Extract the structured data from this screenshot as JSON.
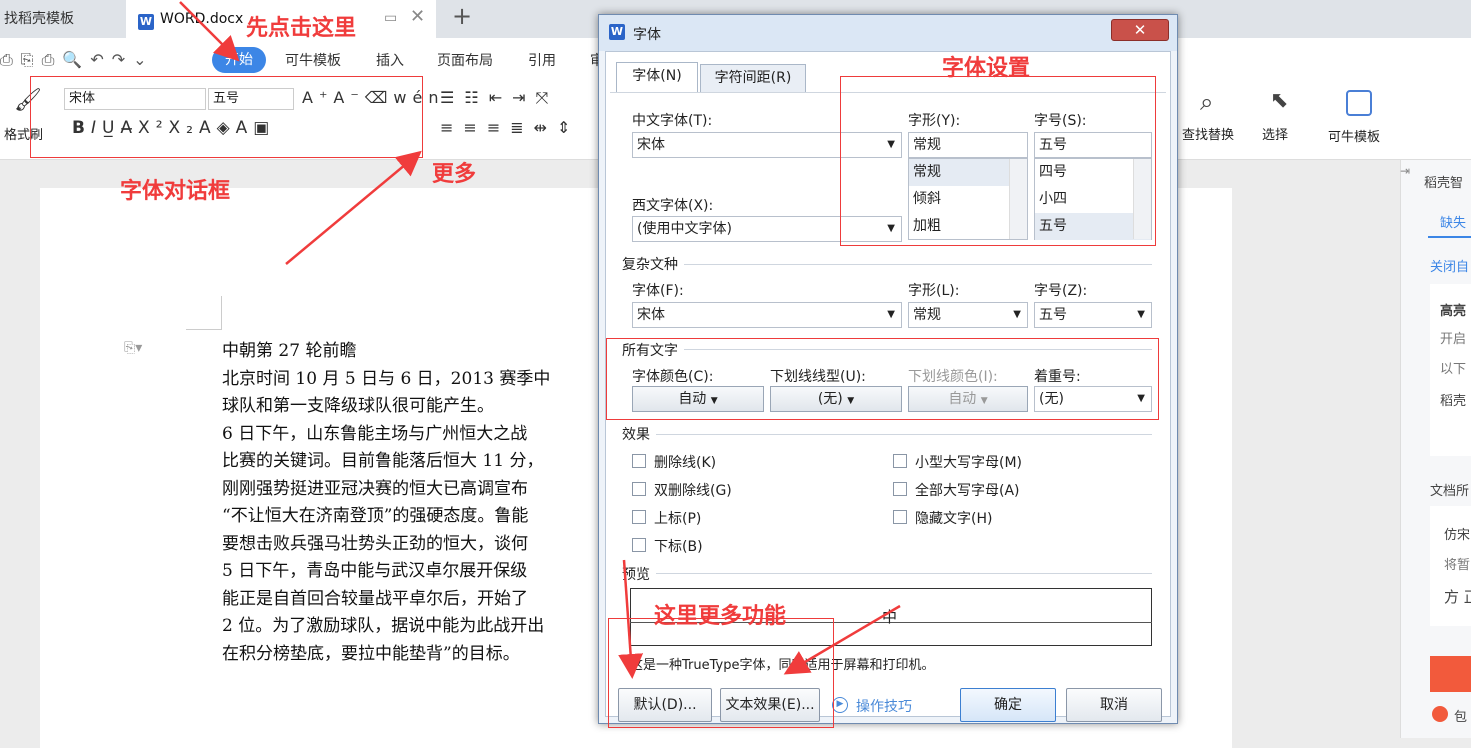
{
  "tabs": {
    "tab1": "找稻壳模板",
    "tab2": "WORD.docx"
  },
  "menu": {
    "start": "开始",
    "items": [
      "可牛模板",
      "插入",
      "页面布局",
      "引用",
      "审"
    ]
  },
  "toolbar": {
    "format_painter": "格式刷",
    "font": "宋体",
    "size": "五号",
    "find_replace": "查找替换",
    "select": "选择",
    "kn_template": "可牛模板"
  },
  "annotations": {
    "click_first": "先点击这里",
    "font_dialog": "字体对话框",
    "more": "更多",
    "font_settings": "字体设置",
    "more_functions": "这里更多功能"
  },
  "document": {
    "lines": [
      "中朝第 27 轮前瞻",
      "北京时间 10 月 5 日与 6 日，2013 赛季中",
      "球队和第一支降级球队很可能产生。",
      "6 日下午，山东鲁能主场与广州恒大之战",
      "比赛的关键词。目前鲁能落后恒大 11 分，",
      "刚刚强势挺进亚冠决赛的恒大已高调宣布",
      "“不让恒大在济南登顶”的强硬态度。鲁能",
      "要想击败兵强马壮势头正劲的恒大，谈何",
      "5 日下午，青岛中能与武汉卓尔展开保级",
      "能正是自首回合较量战平卓尔后，开始了",
      "2 位。为了激励球队，据说中能为此战开出",
      "在积分榜垫底，要拉中能垫背”的目标。"
    ]
  },
  "right_panel": {
    "items": [
      "稻壳智",
      "缺失",
      "关闭自",
      "高亮",
      "开启",
      "以下",
      "稻壳",
      "文档所",
      "仿宋",
      "将暂",
      "方 正",
      "包"
    ]
  },
  "dialog": {
    "title": "字体",
    "tabs": [
      "字体(N)",
      "字符间距(R)"
    ],
    "cn_font_label": "中文字体(T):",
    "cn_font": "宋体",
    "style_label": "字形(Y):",
    "style_value": "常规",
    "style_list": [
      "常规",
      "倾斜",
      "加粗"
    ],
    "size_label": "字号(S):",
    "size_value": "五号",
    "size_list": [
      "四号",
      "小四",
      "五号"
    ],
    "west_font_label": "西文字体(X):",
    "west_font": "(使用中文字体)",
    "complex_section": "复杂文种",
    "complex_font_label": "字体(F):",
    "complex_font": "宋体",
    "complex_style_label": "字形(L):",
    "complex_style": "常规",
    "complex_size_label": "字号(Z):",
    "complex_size": "五号",
    "all_text_section": "所有文字",
    "color_label": "字体颜色(C):",
    "color_value": "自动",
    "underline_label": "下划线线型(U):",
    "underline_value": "(无)",
    "underline_color_label": "下划线颜色(I):",
    "underline_color_value": "自动",
    "emphasis_label": "着重号:",
    "emphasis_value": "(无)",
    "effects_section": "效果",
    "effects_left": [
      "删除线(K)",
      "双删除线(G)",
      "上标(P)",
      "下标(B)"
    ],
    "effects_right": [
      "小型大写字母(M)",
      "全部大写字母(A)",
      "隐藏文字(H)"
    ],
    "preview_section": "预览",
    "preview_char": "中",
    "preview_note": "这是一种TrueType字体，同时适用于屏幕和打印机。",
    "default_btn": "默认(D)...",
    "text_effect_btn": "文本效果(E)...",
    "tips": "操作技巧",
    "ok": "确定",
    "cancel": "取消"
  }
}
